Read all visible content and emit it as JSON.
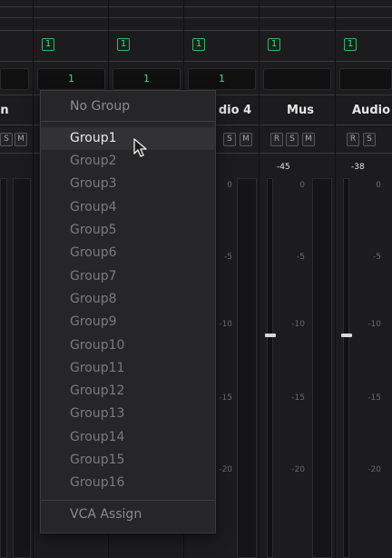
{
  "tracks": [
    {
      "name": "n",
      "link_badge": "1",
      "vca_slot": "",
      "db_readout": "",
      "buttons": [
        "S",
        "M"
      ]
    },
    {
      "name": "",
      "link_badge": "1",
      "vca_slot": "1",
      "db_readout": "",
      "buttons": []
    },
    {
      "name": "",
      "link_badge": "1",
      "vca_slot": "1",
      "db_readout": "",
      "buttons": []
    },
    {
      "name": "dio 4",
      "link_badge": "1",
      "vca_slot": "1",
      "db_readout": "",
      "buttons": [
        "S",
        "M"
      ]
    },
    {
      "name": "Mus",
      "link_badge": "1",
      "vca_slot": "",
      "db_readout": "-45",
      "buttons": [
        "R",
        "S",
        "M"
      ]
    },
    {
      "name": "Audio",
      "link_badge": "1",
      "vca_slot": "",
      "db_readout": "-38",
      "buttons": [
        "R",
        "S"
      ]
    }
  ],
  "meter_scale": [
    "0",
    "-5",
    "-10",
    "-15",
    "-20"
  ],
  "group_menu": {
    "header": "No Group",
    "items": [
      "Group1",
      "Group2",
      "Group3",
      "Group4",
      "Group5",
      "Group6",
      "Group7",
      "Group8",
      "Group9",
      "Group10",
      "Group11",
      "Group12",
      "Group13",
      "Group14",
      "Group15",
      "Group16"
    ],
    "hovered_item": "Group1",
    "footer": "VCA Assign"
  },
  "colors": {
    "accent_green": "#4fd07f",
    "background": "#1c1c1e",
    "menu_background": "#262628"
  }
}
